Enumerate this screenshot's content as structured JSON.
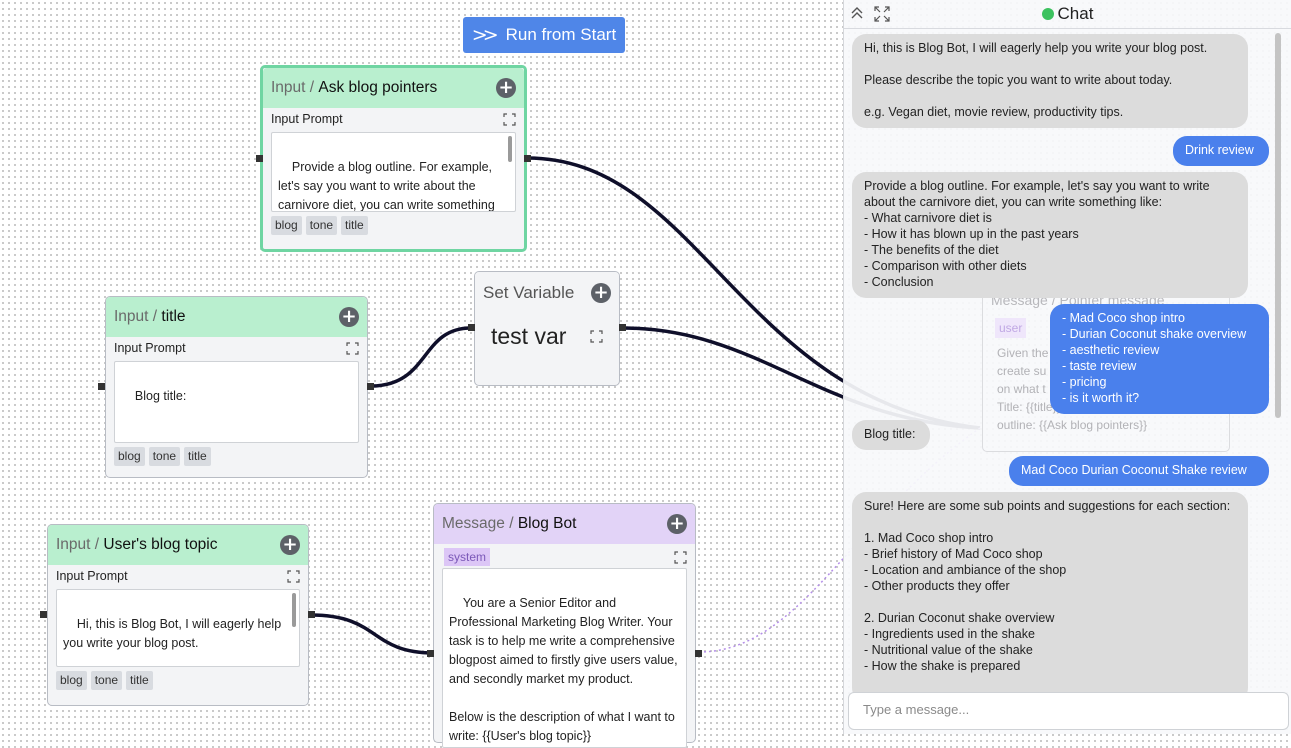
{
  "toolbar": {
    "run_label": "Run from Start"
  },
  "nodes": {
    "ask_pointers": {
      "kind": "Input",
      "name": "Ask blog pointers",
      "prompt_label": "Input Prompt",
      "text": "Provide a blog outline. For example, let's say you want to write about the carnivore diet, you can write something like:",
      "tags": [
        "blog",
        "tone",
        "title"
      ]
    },
    "title": {
      "kind": "Input",
      "name": "title",
      "prompt_label": "Input Prompt",
      "text": "Blog title:",
      "tags": [
        "blog",
        "tone",
        "title"
      ]
    },
    "set_var": {
      "name": "Set Variable",
      "value": "test var"
    },
    "topic": {
      "kind": "Input",
      "name": "User's blog topic",
      "prompt_label": "Input Prompt",
      "text": "Hi, this is Blog Bot, I will eagerly help you write your blog post.\n\nPlease describe the topic you want to",
      "tags": [
        "blog",
        "tone",
        "title"
      ]
    },
    "blog_bot": {
      "kind": "Message",
      "name": "Blog Bot",
      "role": "system",
      "text": "You are a Senior Editor and Professional Marketing Blog Writer. Your task is to help me write a comprehensive blogpost aimed to firstly give users value, and secondly market my product.\n\nBelow is the description of what I want to write: {{User's blog topic}}"
    }
  },
  "ghost_node": {
    "header": "Message / Pointer message",
    "role": "user",
    "lines": [
      "Given the",
      "create su",
      "on what t",
      "Title: {{title}}",
      "outline: {{Ask blog pointers}}"
    ]
  },
  "chat": {
    "title": "Chat",
    "input_placeholder": "Type a message...",
    "messages": [
      {
        "from": "bot",
        "text": "Hi, this is Blog Bot, I will eagerly help you write your blog post.\n\nPlease describe the topic you want to write about today.\n\ne.g. Vegan diet, movie review, productivity tips."
      },
      {
        "from": "user",
        "text": "Drink review"
      },
      {
        "from": "bot",
        "text": "Provide a blog outline. For example, let's say you want to write about the carnivore diet, you can write something like:\n- What carnivore diet is\n- How it has blown up in the past years\n- The benefits of the diet\n- Comparison with other diets\n- Conclusion"
      },
      {
        "from": "user",
        "text": "- Mad Coco shop intro\n- Durian Coconut shake overview\n- aesthetic review\n- taste review\n- pricing\n- is it worth it?"
      },
      {
        "from": "bot",
        "text": "Blog title:"
      },
      {
        "from": "user",
        "text": "Mad Coco Durian Coconut Shake review"
      },
      {
        "from": "bot",
        "text": "Sure! Here are some sub points and suggestions for each section:\n\n1. Mad Coco shop intro\n- Brief history of Mad Coco shop\n- Location and ambiance of the shop\n- Other products they offer\n\n2. Durian Coconut shake overview\n- Ingredients used in the shake\n- Nutritional value of the shake\n- How the shake is prepared"
      }
    ]
  },
  "colors": {
    "accent": "#4f86e8",
    "input_head": "#b9efcf",
    "message_head": "#e2d3f7",
    "selected_border": "#6fd5a2",
    "user_bubble": "#4a80ec",
    "bot_bubble": "#dcdcdc"
  }
}
